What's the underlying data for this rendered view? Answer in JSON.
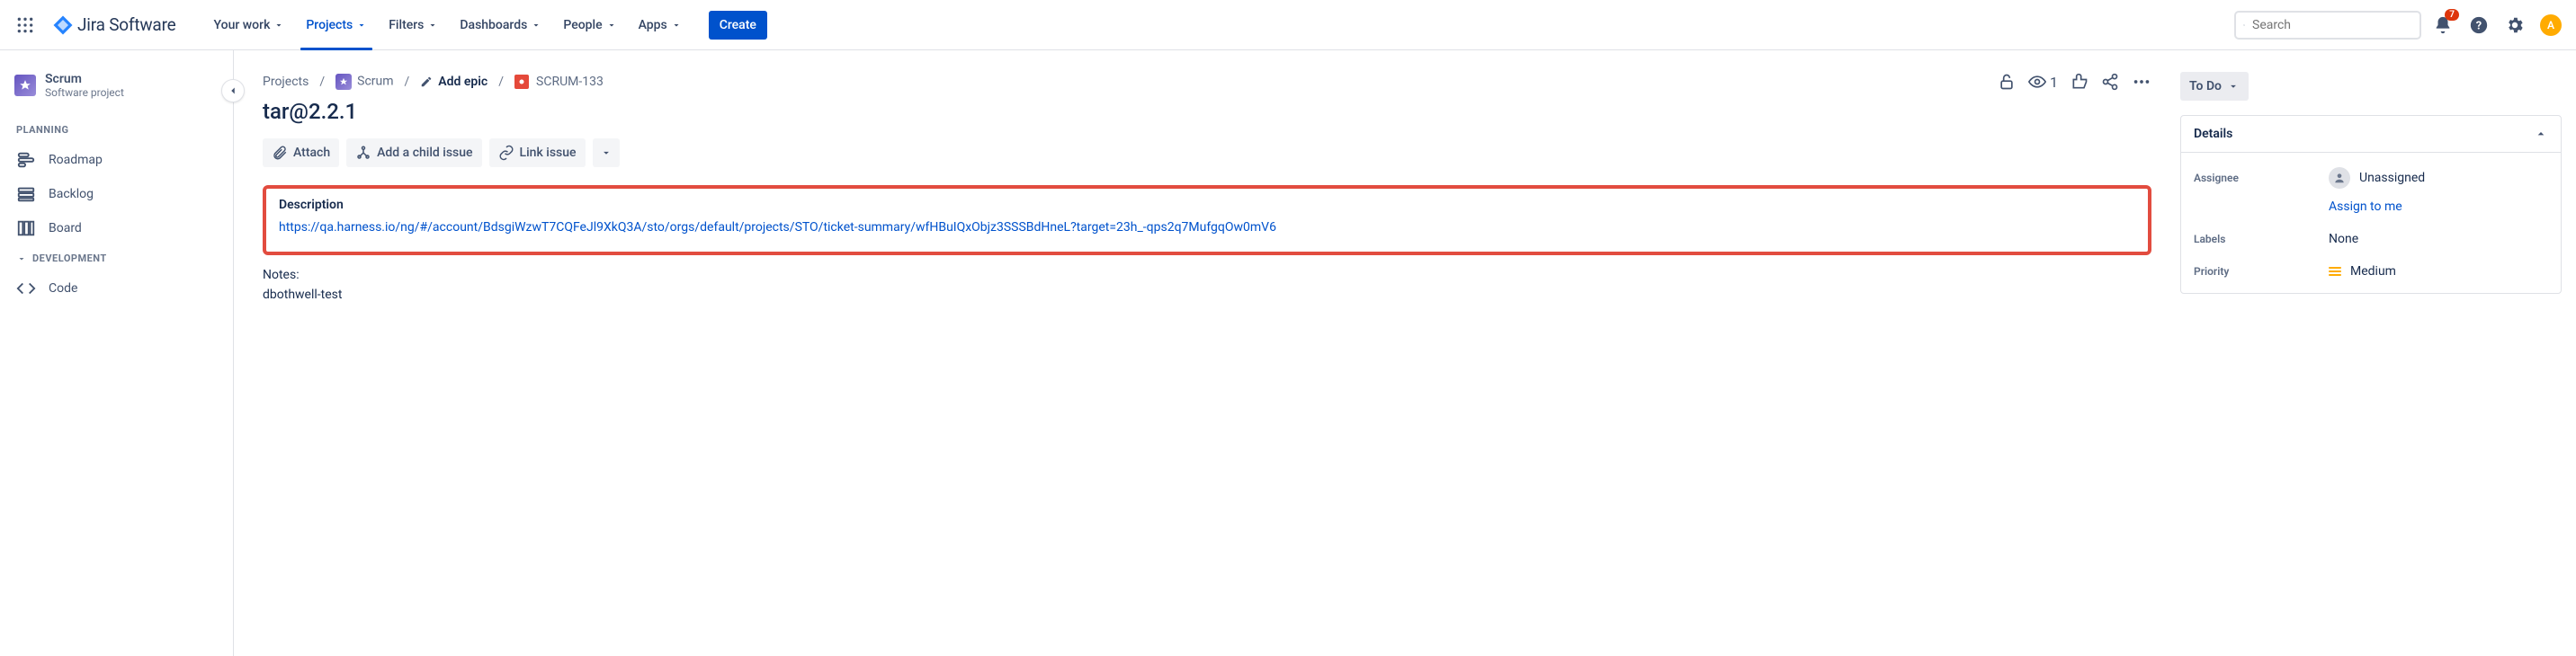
{
  "topbar": {
    "logo_text": "Jira Software",
    "nav": [
      {
        "label": "Your work"
      },
      {
        "label": "Projects",
        "active": true
      },
      {
        "label": "Filters"
      },
      {
        "label": "Dashboards"
      },
      {
        "label": "People"
      },
      {
        "label": "Apps"
      }
    ],
    "create_label": "Create",
    "search_placeholder": "Search",
    "notification_count": "7",
    "avatar_initial": "A"
  },
  "sidebar": {
    "project_name": "Scrum",
    "project_type": "Software project",
    "sections": [
      {
        "title": "PLANNING",
        "items": [
          {
            "label": "Roadmap",
            "icon": "roadmap"
          },
          {
            "label": "Backlog",
            "icon": "backlog"
          },
          {
            "label": "Board",
            "icon": "board"
          }
        ]
      },
      {
        "title": "DEVELOPMENT",
        "collapsible": true,
        "items": [
          {
            "label": "Code",
            "icon": "code"
          }
        ]
      }
    ]
  },
  "breadcrumb": {
    "root": "Projects",
    "project": "Scrum",
    "add_epic": "Add epic",
    "issue_key": "SCRUM-133"
  },
  "issue": {
    "title": "tar@2.2.1",
    "actions": {
      "attach": "Attach",
      "add_child": "Add a child issue",
      "link": "Link issue"
    },
    "description_label": "Description",
    "description_link": "https://qa.harness.io/ng/#/account/BdsgiWzwT7CQFeJl9XkQ3A/sto/orgs/default/projects/STO/ticket-summary/wfHBuIQxObjz3SSSBdHneL?target=23h_-qps2q7MufgqOw0mV6",
    "notes_label": "Notes:",
    "notes_body": "dbothwell-test"
  },
  "header_actions": {
    "watchers": "1"
  },
  "right": {
    "status": "To Do",
    "details_title": "Details",
    "fields": {
      "assignee": {
        "label": "Assignee",
        "value": "Unassigned",
        "assign_link": "Assign to me"
      },
      "labels": {
        "label": "Labels",
        "value": "None"
      },
      "priority": {
        "label": "Priority",
        "value": "Medium"
      }
    }
  }
}
